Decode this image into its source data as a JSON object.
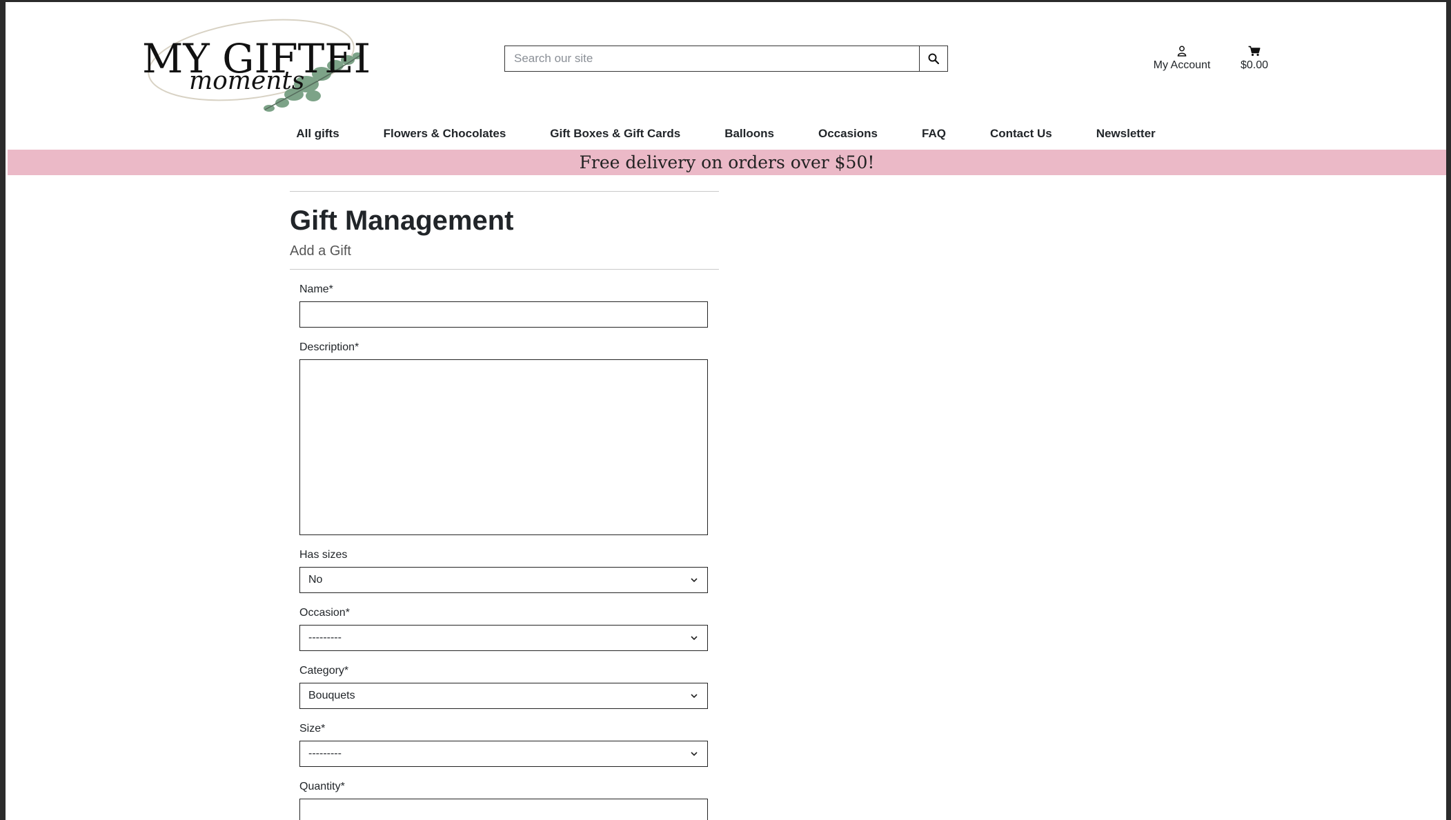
{
  "header": {
    "logo_text_main": "MY GIFTED",
    "logo_text_script": "moments",
    "search": {
      "placeholder": "Search our site"
    },
    "account_label": "My Account",
    "cart_total": "$0.00"
  },
  "nav": {
    "items": [
      {
        "label": "All gifts"
      },
      {
        "label": "Flowers & Chocolates"
      },
      {
        "label": "Gift Boxes & Gift Cards"
      },
      {
        "label": "Balloons"
      },
      {
        "label": "Occasions"
      },
      {
        "label": "FAQ"
      },
      {
        "label": "Contact Us"
      },
      {
        "label": "Newsletter"
      }
    ]
  },
  "banner": {
    "text": "Free delivery on orders over $50!"
  },
  "page": {
    "title": "Gift Management",
    "subtitle": "Add a Gift"
  },
  "form": {
    "name_label": "Name*",
    "name_value": "",
    "description_label": "Description*",
    "description_value": "",
    "has_sizes_label": "Has sizes",
    "has_sizes_value": "No",
    "occasion_label": "Occasion*",
    "occasion_value": "---------",
    "category_label": "Category*",
    "category_value": "Bouquets",
    "size_label": "Size*",
    "size_value": "---------",
    "quantity_label": "Quantity*"
  },
  "colors": {
    "banner_bg": "#ebb9c7",
    "text": "#212529",
    "leaf_green": "#6f9a7c"
  }
}
